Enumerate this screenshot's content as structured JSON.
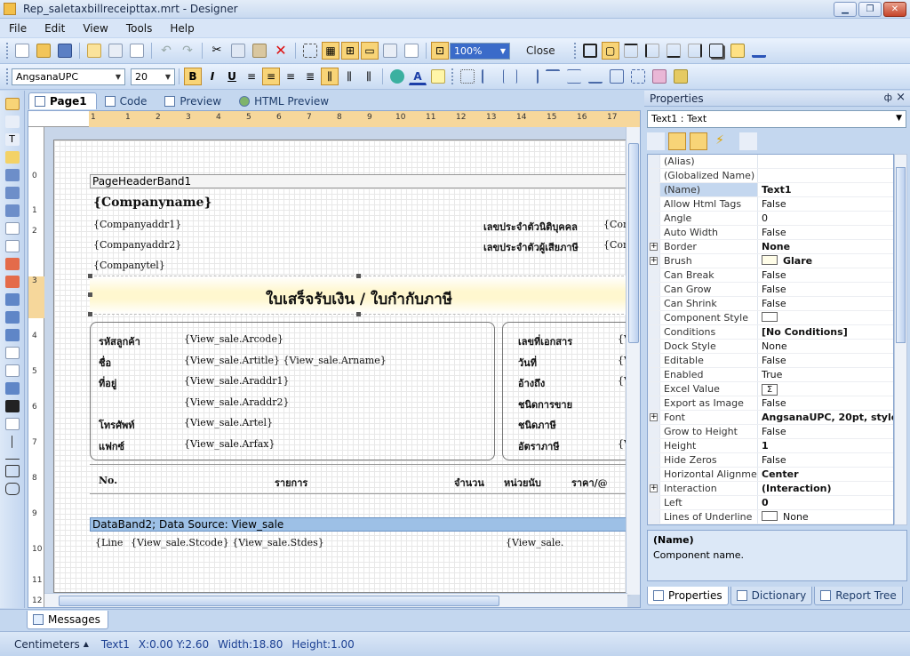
{
  "window": {
    "title": "Rep_saletaxbillreceipttax.mrt - Designer"
  },
  "menu": [
    "File",
    "Edit",
    "View",
    "Tools",
    "Help"
  ],
  "toolbar1": {
    "zoom": "100%",
    "close_label": "Close"
  },
  "toolbar2": {
    "font": "AngsanaUPC",
    "size": "20",
    "bold": "B",
    "italic": "I",
    "underline": "U",
    "text_color": "A"
  },
  "doc_tabs": [
    "Page1",
    "Code",
    "Preview",
    "HTML Preview"
  ],
  "ruler": {
    "h": [
      "1",
      "1",
      "2",
      "3",
      "4",
      "5",
      "6",
      "7",
      "8",
      "9",
      "10",
      "11",
      "12",
      "13",
      "14",
      "15",
      "16",
      "17"
    ],
    "v": [
      "0",
      "1",
      "2",
      "3",
      "4",
      "5",
      "6",
      "7",
      "8",
      "9",
      "10",
      "11",
      "12"
    ]
  },
  "report": {
    "page_header_band": "PageHeaderBand1",
    "company_name": "{Companyname}",
    "company_addr1": "{Companyaddr1}",
    "company_addr2": "{Companyaddr2}",
    "company_tel": "{Companytel}",
    "tax_id_label": "เลขประจำตัวนิติบุคคล",
    "tax_payer_label": "เลขประจำตัวผู้เสียภาษี",
    "right_cut_1": "{Com",
    "right_cut_2": "{Com",
    "title": "ใบเสร็จรับเงิน / ใบกำกับภาษี",
    "cust_labels": [
      "รหัสลูกค้า",
      "ชื่อ",
      "ที่อยู่",
      "",
      "โทรศัพท์",
      "แฟกซ์"
    ],
    "cust_values": [
      "{View_sale.Arcode}",
      "{View_sale.Artitle} {View_sale.Arname}",
      "{View_sale.Araddr1}",
      "{View_sale.Araddr2}",
      "{View_sale.Artel}",
      "{View_sale.Arfax}"
    ],
    "doc_labels": [
      "เลขที่เอกสาร",
      "วันที่",
      "อ้างถึง",
      "ชนิดการขาย",
      "ชนิดภาษี",
      "อัตราภาษี"
    ],
    "doc_values_cut": [
      "{V",
      "{V",
      "{V",
      "",
      "",
      "{V"
    ],
    "col_no": "No.",
    "col_item": "รายการ",
    "col_qty": "จำนวน",
    "col_unit": "หน่วยนับ",
    "col_price": "ราคา/@",
    "data_band": "DataBand2; Data Source: View_sale",
    "row_line": "{Line",
    "row_stcode": "{View_sale.Stcode} {View_sale.Stdes}",
    "row_cut": "{View_sale."
  },
  "properties": {
    "header": "Properties",
    "pin": "ф",
    "close": "×",
    "object": "Text1 : Text",
    "rows": [
      {
        "name": "(Alias)",
        "value": "",
        "expand": false
      },
      {
        "name": "(Globalized Name)",
        "value": "",
        "expand": false
      },
      {
        "name": "(Name)",
        "value": "Text1",
        "expand": false,
        "bold": true,
        "selected": true
      },
      {
        "name": "Allow Html Tags",
        "value": "False",
        "expand": false
      },
      {
        "name": "Angle",
        "value": "0",
        "expand": false
      },
      {
        "name": "Auto Width",
        "value": "False",
        "expand": false
      },
      {
        "name": "Border",
        "value": "None",
        "expand": true,
        "bold": true
      },
      {
        "name": "Brush",
        "value": "Glare",
        "expand": true,
        "bold": true,
        "swatch": "glare"
      },
      {
        "name": "Can Break",
        "value": "False",
        "expand": false
      },
      {
        "name": "Can Grow",
        "value": "False",
        "expand": false
      },
      {
        "name": "Can Shrink",
        "value": "False",
        "expand": false
      },
      {
        "name": "Component Style",
        "value": "",
        "expand": false,
        "swatch": "white"
      },
      {
        "name": "Conditions",
        "value": "[No Conditions]",
        "expand": false,
        "bold": true
      },
      {
        "name": "Dock Style",
        "value": "None",
        "expand": false
      },
      {
        "name": "Editable",
        "value": "False",
        "expand": false
      },
      {
        "name": "Enabled",
        "value": "True",
        "expand": false
      },
      {
        "name": "Excel Value",
        "value": "Σ",
        "expand": false,
        "sigma": true
      },
      {
        "name": "Export as Image",
        "value": "False",
        "expand": false
      },
      {
        "name": "Font",
        "value": "AngsanaUPC, 20pt, style=Bo",
        "expand": true,
        "bold": true
      },
      {
        "name": "Grow to Height",
        "value": "False",
        "expand": false
      },
      {
        "name": "Height",
        "value": "1",
        "expand": false,
        "bold": true
      },
      {
        "name": "Hide Zeros",
        "value": "False",
        "expand": false
      },
      {
        "name": "Horizontal Alignment",
        "value": "Center",
        "expand": false,
        "bold": true
      },
      {
        "name": "Interaction",
        "value": "(Interaction)",
        "expand": true,
        "bold": true
      },
      {
        "name": "Left",
        "value": "0",
        "expand": false,
        "bold": true
      },
      {
        "name": "Lines of Underline",
        "value": "None",
        "expand": false,
        "swatch": "white"
      }
    ],
    "desc_title": "(Name)",
    "desc_text": "Component name.",
    "tabs": [
      "Properties",
      "Dictionary",
      "Report Tree"
    ]
  },
  "messages_tab": "Messages",
  "status": {
    "units": "Centimeters",
    "component": "Text1",
    "pos": "X:0.00  Y:2.60",
    "width": "Width:18.80",
    "height": "Height:1.00"
  }
}
